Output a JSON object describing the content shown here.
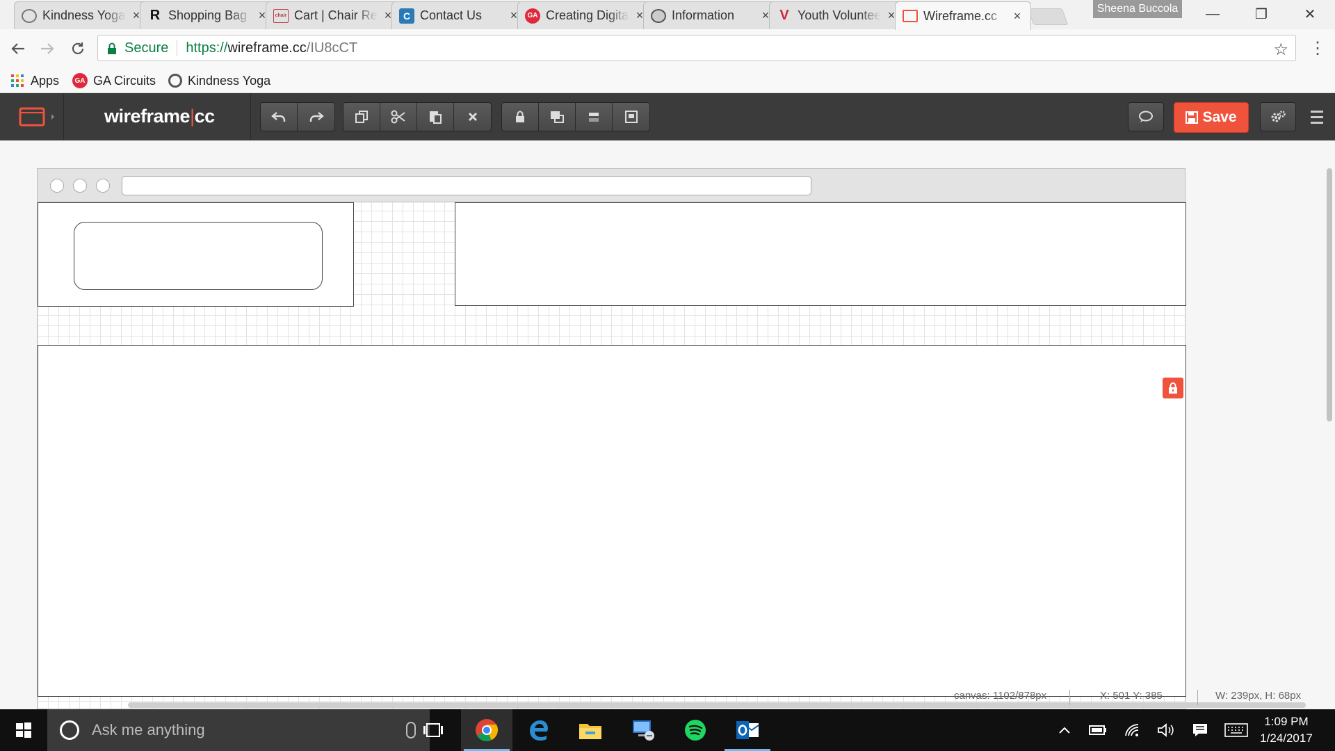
{
  "browser": {
    "tabs": [
      {
        "title": "Kindness Yoga",
        "favicon": "circle-icon",
        "active": false
      },
      {
        "title": "Shopping Bag",
        "favicon": "r-logo-icon",
        "active": false
      },
      {
        "title": "Cart | Chair Rental",
        "favicon": "chair-rental-icon",
        "active": false
      },
      {
        "title": "Contact Us",
        "favicon": "c-logo-icon",
        "active": false
      },
      {
        "title": "Creating Digital",
        "favicon": "ga-logo-icon",
        "active": false
      },
      {
        "title": "Information",
        "favicon": "seal-icon",
        "active": false
      },
      {
        "title": "Youth Volunteer",
        "favicon": "v-logo-icon",
        "active": false
      },
      {
        "title": "Wireframe.cc",
        "favicon": "wireframe-icon",
        "active": true
      }
    ],
    "close_glyph": "×",
    "user_name": "Sheena Buccola",
    "window_buttons": {
      "minimize": "—",
      "restore": "❐",
      "close": "✕"
    },
    "omnibox": {
      "secure_label": "Secure",
      "url_scheme": "https://",
      "url_host": "wireframe.cc",
      "url_path": "/IU8cCT"
    },
    "bookmarks": [
      {
        "label": "Apps",
        "icon": "apps-grid-icon"
      },
      {
        "label": "GA Circuits",
        "icon": "ga-logo-icon"
      },
      {
        "label": "Kindness Yoga",
        "icon": "circle-icon"
      }
    ]
  },
  "app": {
    "logo_left": "wireframe",
    "logo_sep": "|",
    "logo_right": "cc",
    "save_label": "Save",
    "toolbar_groups": [
      [
        "undo-icon",
        "redo-icon"
      ],
      [
        "copy-icon",
        "cut-icon",
        "paste-icon",
        "delete-icon"
      ],
      [
        "lock-icon",
        "arrange-icon",
        "align-icon",
        "group-icon"
      ]
    ]
  },
  "status": {
    "canvas": "canvas: 1102/878px",
    "coords": "X: 501 Y: 385",
    "size": "W: 239px, H: 68px"
  },
  "taskbar": {
    "search_placeholder": "Ask me anything",
    "time": "1:09 PM",
    "date": "1/24/2017",
    "apps": [
      "chrome-icon",
      "edge-icon",
      "file-explorer-icon",
      "remote-desktop-icon",
      "spotify-icon",
      "outlook-icon"
    ]
  },
  "colors": {
    "accent": "#f0533b",
    "header_bg": "#3b3b3b",
    "secure_green": "#0b8043"
  }
}
